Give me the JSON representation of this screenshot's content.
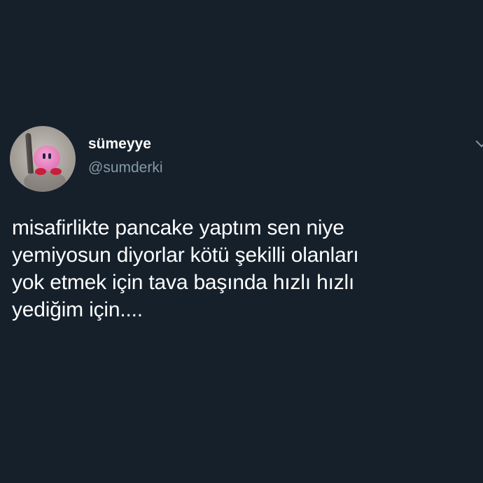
{
  "user": {
    "display_name": "sümeyye",
    "handle": "@sumderki"
  },
  "tweet": {
    "text": "misafirlikte pancake yaptım sen niye\nyemiyosun diyorlar kötü şekilli olanları\nyok etmek için tava başında hızlı hızlı\nyediğim için...."
  },
  "icons": {
    "more": "chevron-down-icon",
    "avatar": "avatar-kirby-with-knife"
  },
  "colors": {
    "background": "#15202b",
    "text_primary": "#ffffff",
    "text_secondary": "#8899a6"
  }
}
